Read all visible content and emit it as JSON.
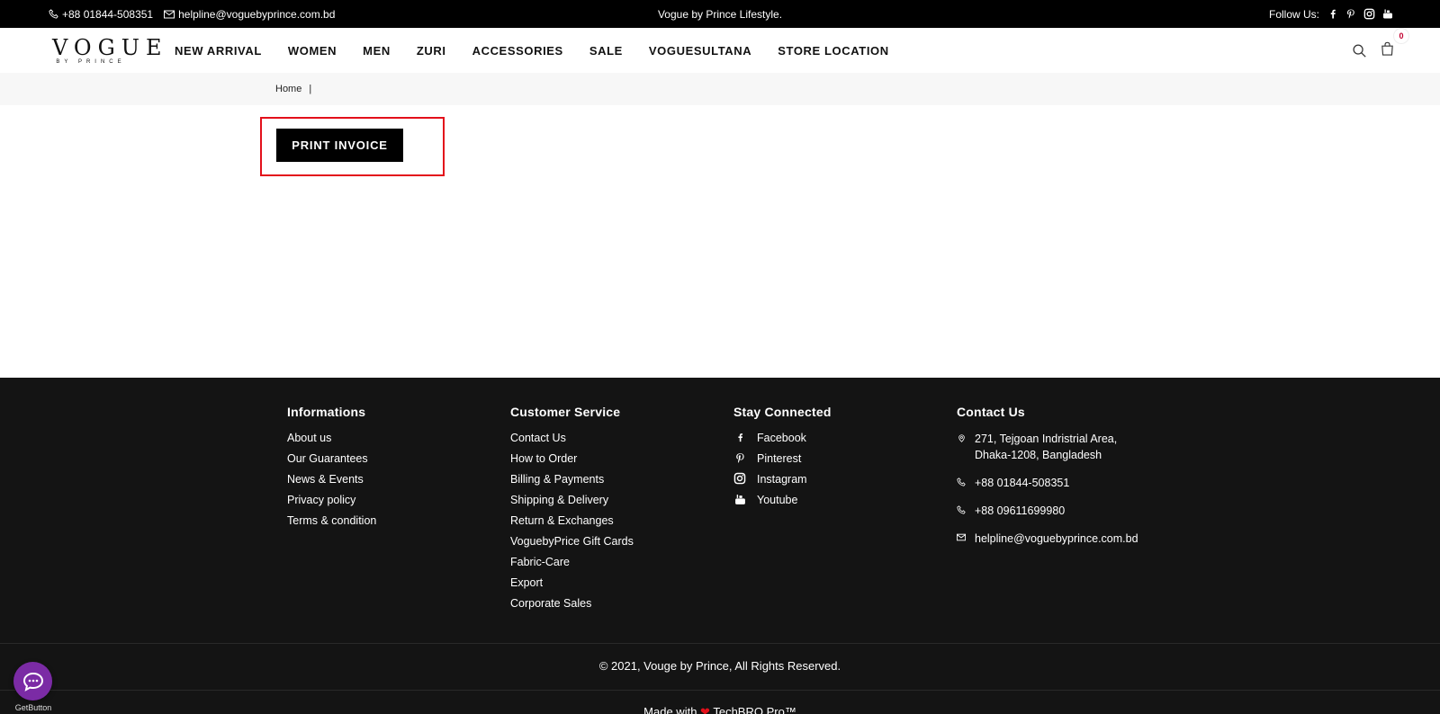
{
  "topbar": {
    "phone": "+88 01844-508351",
    "email": "helpline@voguebyprince.com.bd",
    "tagline": "Vogue by Prince Lifestyle.",
    "follow_label": "Follow Us:"
  },
  "header": {
    "logo_text": "VOGUE",
    "logo_sub": "BY PRINCE",
    "nav": [
      "NEW ARRIVAL",
      "WOMEN",
      "MEN",
      "ZURI",
      "ACCESSORIES",
      "SALE",
      "VOGUESULTANA",
      "STORE LOCATION"
    ],
    "cart_count": "0"
  },
  "breadcrumb": {
    "home": "Home",
    "separator": "|"
  },
  "main": {
    "print_button": "PRINT INVOICE"
  },
  "footer": {
    "informations": {
      "title": "Informations",
      "items": [
        "About us",
        "Our Guarantees",
        "News & Events",
        "Privacy policy",
        "Terms & condition"
      ]
    },
    "customer_service": {
      "title": "Customer Service",
      "items": [
        "Contact Us",
        "How to Order",
        "Billing & Payments",
        "Shipping & Delivery",
        "Return & Exchanges",
        "VoguebyPrice Gift Cards",
        "Fabric-Care",
        "Export",
        "Corporate Sales"
      ]
    },
    "stay_connected": {
      "title": "Stay Connected",
      "items": [
        "Facebook",
        "Pinterest",
        "Instagram",
        "Youtube"
      ]
    },
    "contact_us": {
      "title": "Contact Us",
      "address": "271, Tejgoan Indristrial Area, Dhaka-1208, Bangladesh",
      "phone1": "+88 01844-508351",
      "phone2": "+88 09611699980",
      "email": "helpline@voguebyprince.com.bd"
    },
    "copyright": "© 2021, Vouge by Prince, All Rights Reserved.",
    "made_with_prefix": "Made with",
    "made_with_suffix": "TechBRO Pro™"
  },
  "chat_widget": {
    "label": "GetButton"
  },
  "colors": {
    "accent_red": "#e3101b",
    "footer_bg": "#141414",
    "chat_purple": "#7b2ba5"
  }
}
